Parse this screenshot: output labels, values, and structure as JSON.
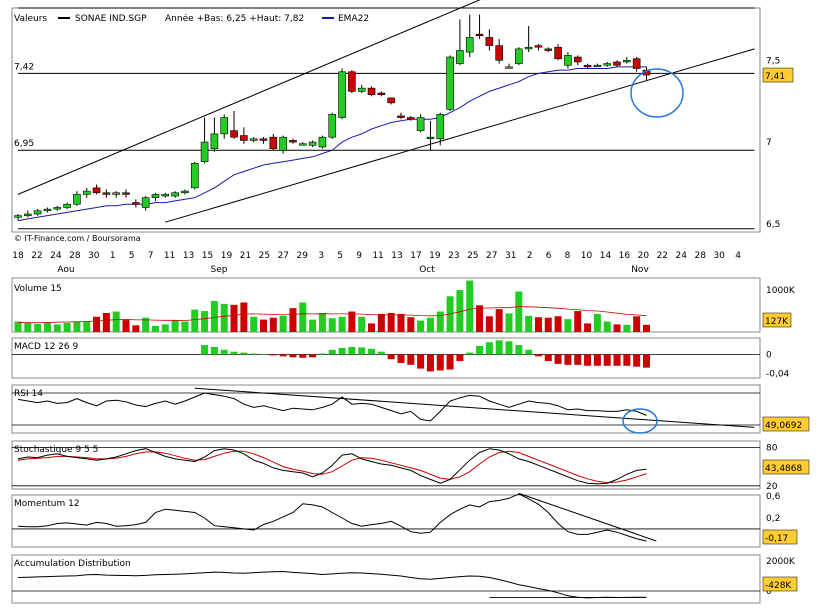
{
  "header": {
    "valeurs": "Valeurs",
    "symbol": "SONAE IND.SGP",
    "range": "Année +Bas: 6,25 +Haut: 7,82",
    "ema": "EMA22"
  },
  "colors": {
    "up": "#22cc22",
    "down": "#cc0000",
    "ema": "#1a1aaa",
    "badge": "#ffcc33",
    "highlight": "#2277dd",
    "grid_line": "#000000"
  },
  "chart_data": [
    {
      "type": "candlestick",
      "title": "SONAE IND.SGP",
      "legend": [
        "SONAE IND.SGP",
        "EMA22"
      ],
      "credit": "© IT-Finance.com / Boursorama",
      "ylim": [
        6.45,
        7.82
      ],
      "y_ticks_right": [
        7.5,
        7,
        6.5
      ],
      "y_tick_labels_right": [
        "7,5",
        "7",
        "6,5"
      ],
      "h_levels": [
        7.42,
        6.95
      ],
      "h_level_labels": [
        "7,42",
        "6,95"
      ],
      "current": "7,41",
      "x_tick_labels": [
        "18",
        "22",
        "24",
        "28",
        "30",
        "1",
        "5",
        "7",
        "11",
        "13",
        "15",
        "19",
        "21",
        "25",
        "27",
        "29",
        "3",
        "5",
        "9",
        "11",
        "13",
        "17",
        "19",
        "23",
        "25",
        "27",
        "31",
        "2",
        "6",
        "8",
        "10",
        "14",
        "16",
        "20",
        "22",
        "24",
        "28",
        "30",
        "4"
      ],
      "month_labels": [
        "Aou",
        "Sep",
        "Oct",
        "Nov"
      ],
      "candles": [
        [
          6.54,
          6.55,
          6.52,
          6.56
        ],
        [
          6.55,
          6.56,
          6.54,
          6.58
        ],
        [
          6.56,
          6.58,
          6.55,
          6.59
        ],
        [
          6.58,
          6.59,
          6.57,
          6.6
        ],
        [
          6.59,
          6.6,
          6.58,
          6.61
        ],
        [
          6.6,
          6.62,
          6.59,
          6.63
        ],
        [
          6.62,
          6.68,
          6.61,
          6.7
        ],
        [
          6.68,
          6.7,
          6.66,
          6.72
        ],
        [
          6.72,
          6.69,
          6.68,
          6.74
        ],
        [
          6.69,
          6.68,
          6.66,
          6.71
        ],
        [
          6.68,
          6.69,
          6.66,
          6.7
        ],
        [
          6.69,
          6.68,
          6.66,
          6.71
        ],
        [
          6.63,
          6.62,
          6.6,
          6.65
        ],
        [
          6.6,
          6.66,
          6.58,
          6.67
        ],
        [
          6.66,
          6.68,
          6.64,
          6.69
        ],
        [
          6.67,
          6.68,
          6.66,
          6.69
        ],
        [
          6.67,
          6.69,
          6.66,
          6.7
        ],
        [
          6.69,
          6.7,
          6.68,
          6.71
        ],
        [
          6.72,
          6.87,
          6.71,
          6.88
        ],
        [
          6.88,
          7.0,
          6.87,
          7.15
        ],
        [
          6.96,
          7.05,
          6.94,
          7.15
        ],
        [
          7.05,
          7.15,
          7.02,
          7.17
        ],
        [
          7.07,
          7.03,
          7.02,
          7.19
        ],
        [
          7.04,
          7.01,
          6.99,
          7.09
        ],
        [
          7.01,
          7.02,
          7.0,
          7.03
        ],
        [
          7.02,
          7.01,
          6.99,
          7.03
        ],
        [
          7.03,
          6.96,
          6.95,
          7.05
        ],
        [
          6.95,
          7.03,
          6.93,
          7.04
        ],
        [
          7.01,
          7.0,
          6.99,
          7.02
        ],
        [
          6.99,
          6.99,
          6.98,
          7.0
        ],
        [
          6.98,
          7.0,
          6.97,
          7.01
        ],
        [
          6.97,
          7.03,
          6.96,
          7.04
        ],
        [
          7.03,
          7.17,
          7.02,
          7.18
        ],
        [
          7.15,
          7.43,
          7.14,
          7.45
        ],
        [
          7.43,
          7.31,
          7.3,
          7.44
        ],
        [
          7.31,
          7.33,
          7.3,
          7.35
        ],
        [
          7.33,
          7.29,
          7.28,
          7.34
        ],
        [
          7.3,
          7.29,
          7.28,
          7.31
        ],
        [
          7.27,
          7.24,
          7.23,
          7.27
        ],
        [
          7.16,
          7.15,
          7.14,
          7.18
        ],
        [
          7.15,
          7.14,
          7.13,
          7.16
        ],
        [
          7.07,
          7.15,
          7.06,
          7.17
        ],
        [
          7.03,
          7.03,
          6.95,
          7.13
        ],
        [
          7.02,
          7.17,
          6.98,
          7.18
        ],
        [
          7.2,
          7.52,
          7.19,
          7.53
        ],
        [
          7.48,
          7.56,
          7.47,
          7.75
        ],
        [
          7.55,
          7.64,
          7.52,
          7.78
        ],
        [
          7.66,
          7.65,
          7.63,
          7.78
        ],
        [
          7.64,
          7.59,
          7.56,
          7.69
        ],
        [
          7.59,
          7.5,
          7.48,
          7.63
        ],
        [
          7.46,
          7.46,
          7.45,
          7.48
        ],
        [
          7.48,
          7.57,
          7.47,
          7.58
        ],
        [
          7.57,
          7.58,
          7.55,
          7.71
        ],
        [
          7.59,
          7.58,
          7.56,
          7.6
        ],
        [
          7.57,
          7.56,
          7.55,
          7.58
        ],
        [
          7.58,
          7.51,
          7.5,
          7.6
        ],
        [
          7.47,
          7.53,
          7.45,
          7.55
        ],
        [
          7.52,
          7.49,
          7.47,
          7.53
        ],
        [
          7.47,
          7.46,
          7.45,
          7.48
        ],
        [
          7.47,
          7.47,
          7.46,
          7.48
        ],
        [
          7.47,
          7.48,
          7.46,
          7.49
        ],
        [
          7.49,
          7.47,
          7.46,
          7.5
        ],
        [
          7.49,
          7.5,
          7.48,
          7.52
        ],
        [
          7.51,
          7.45,
          7.43,
          7.52
        ],
        [
          7.44,
          7.41,
          7.38,
          7.46
        ]
      ],
      "ema22": [
        6.52,
        6.53,
        6.54,
        6.55,
        6.56,
        6.57,
        6.58,
        6.59,
        6.6,
        6.61,
        6.61,
        6.62,
        6.62,
        6.62,
        6.63,
        6.63,
        6.64,
        6.65,
        6.66,
        6.69,
        6.72,
        6.76,
        6.8,
        6.82,
        6.84,
        6.86,
        6.87,
        6.88,
        6.89,
        6.9,
        6.91,
        6.93,
        6.95,
        7.0,
        7.03,
        7.05,
        7.08,
        7.1,
        7.12,
        7.13,
        7.14,
        7.14,
        7.14,
        7.15,
        7.18,
        7.21,
        7.25,
        7.28,
        7.31,
        7.33,
        7.35,
        7.37,
        7.4,
        7.42,
        7.43,
        7.44,
        7.44,
        7.45,
        7.45,
        7.45,
        7.45,
        7.46,
        7.46,
        7.46,
        7.46
      ],
      "trendlines": [
        {
          "x1": 0,
          "y1": 6.68,
          "x2": 49,
          "y2": 7.92
        },
        {
          "x1": 15,
          "y1": 6.51,
          "x2": 75,
          "y2": 7.57
        },
        {
          "x1": 0,
          "y1": 7.42,
          "x2": 75,
          "y2": 7.42
        },
        {
          "x1": 0,
          "y1": 6.95,
          "x2": 75,
          "y2": 6.95
        },
        {
          "x1": 0,
          "y1": 6.47,
          "x2": 75,
          "y2": 6.47
        },
        {
          "x1": 0,
          "y1": 7.82,
          "x2": 75,
          "y2": 7.82
        }
      ]
    },
    {
      "type": "bar",
      "title": "Volume 15",
      "ylim": [
        0,
        1050
      ],
      "y_ticks": [
        1000
      ],
      "y_tick_labels": [
        "1000K"
      ],
      "current": "127K",
      "values": [
        220,
        190,
        170,
        200,
        160,
        190,
        210,
        220,
        320,
        400,
        430,
        250,
        140,
        300,
        130,
        160,
        250,
        220,
        470,
        440,
        650,
        590,
        570,
        620,
        320,
        260,
        300,
        340,
        500,
        620,
        260,
        400,
        290,
        320,
        430,
        320,
        180,
        380,
        400,
        380,
        310,
        240,
        300,
        430,
        750,
        880,
        1080,
        560,
        330,
        480,
        390,
        850,
        340,
        310,
        300,
        330,
        270,
        440,
        180,
        380,
        220,
        160,
        150,
        330,
        150
      ],
      "colors_by_candle": true,
      "ma": [
        200,
        195,
        195,
        200,
        205,
        210,
        215,
        220,
        230,
        245,
        260,
        265,
        255,
        255,
        250,
        245,
        245,
        240,
        260,
        280,
        305,
        330,
        350,
        375,
        380,
        375,
        370,
        360,
        370,
        385,
        380,
        385,
        380,
        380,
        380,
        375,
        365,
        360,
        360,
        360,
        355,
        345,
        340,
        345,
        380,
        425,
        480,
        500,
        505,
        510,
        510,
        535,
        530,
        520,
        510,
        500,
        480,
        470,
        450,
        440,
        420,
        395,
        370,
        360,
        340
      ]
    },
    {
      "type": "bar",
      "title": "MACD 12 26 9",
      "ylim": [
        -0.05,
        0.035
      ],
      "y_ticks": [
        0,
        -0.04
      ],
      "y_tick_labels": [
        "0",
        "-0,04"
      ],
      "values_start": 19,
      "values": [
        0.02,
        0.016,
        0.01,
        0.006,
        0.004,
        0.002,
        0.001,
        -0.002,
        -0.004,
        -0.006,
        -0.007,
        -0.006,
        0.002,
        0.01,
        0.014,
        0.016,
        0.015,
        0.012,
        0.006,
        -0.01,
        -0.018,
        -0.022,
        -0.03,
        -0.036,
        -0.034,
        -0.032,
        -0.014,
        0.004,
        0.018,
        0.026,
        0.03,
        0.028,
        0.02,
        0.01,
        -0.004,
        -0.014,
        -0.02,
        -0.022,
        -0.022,
        -0.024,
        -0.024,
        -0.024,
        -0.024,
        -0.024,
        -0.026,
        -0.028
      ]
    },
    {
      "type": "line",
      "title": "RSI 14",
      "current": "49,0692",
      "ylim": [
        20,
        80
      ],
      "levels": [
        70,
        30
      ],
      "values": [
        62,
        60,
        58,
        60,
        57,
        58,
        63,
        58,
        54,
        60,
        61,
        59,
        55,
        53,
        57,
        60,
        56,
        60,
        65,
        70,
        68,
        66,
        63,
        56,
        52,
        54,
        51,
        48,
        51,
        50,
        49,
        52,
        56,
        65,
        56,
        57,
        56,
        52,
        48,
        44,
        47,
        37,
        35,
        47,
        60,
        64,
        67,
        66,
        60,
        56,
        52,
        56,
        60,
        58,
        57,
        54,
        49,
        50,
        48,
        48,
        47,
        47,
        49,
        47,
        42
      ],
      "trendline": {
        "x1": 18,
        "y1": 76,
        "x2": 75,
        "y2": 27
      }
    },
    {
      "type": "line",
      "title": "Stochastique 9 5 5",
      "current": "43,4868",
      "ylim": [
        15,
        90
      ],
      "levels": [
        80,
        20
      ],
      "k_line": [
        62,
        65,
        64,
        68,
        70,
        66,
        64,
        62,
        60,
        62,
        65,
        70,
        75,
        78,
        72,
        66,
        62,
        60,
        58,
        65,
        75,
        78,
        76,
        70,
        60,
        55,
        48,
        44,
        42,
        40,
        34,
        40,
        52,
        68,
        70,
        62,
        58,
        54,
        52,
        48,
        44,
        36,
        30,
        24,
        30,
        45,
        60,
        72,
        78,
        76,
        70,
        62,
        58,
        52,
        46,
        40,
        34,
        28,
        24,
        23,
        24,
        30,
        38,
        44,
        46
      ],
      "d_line": [
        60,
        62,
        63,
        64,
        66,
        66,
        65,
        64,
        62,
        62,
        63,
        66,
        70,
        73,
        73,
        71,
        67,
        63,
        60,
        61,
        66,
        71,
        74,
        74,
        70,
        64,
        57,
        50,
        46,
        43,
        39,
        38,
        42,
        51,
        60,
        64,
        63,
        60,
        56,
        52,
        48,
        44,
        38,
        32,
        30,
        34,
        42,
        54,
        65,
        72,
        74,
        72,
        66,
        60,
        54,
        48,
        42,
        36,
        31,
        27,
        25,
        26,
        29,
        34,
        39
      ]
    },
    {
      "type": "line",
      "title": "Momentum 12",
      "current": "-0,17",
      "ylim": [
        -0.33,
        0.62
      ],
      "y_ticks": [
        0.6,
        0.2,
        -0.2
      ],
      "y_tick_labels": [
        "0,6",
        "0,2",
        "-0,2"
      ],
      "levels": [
        0
      ],
      "values": [
        0.05,
        0.04,
        0.04,
        0.06,
        0.1,
        0.11,
        0.09,
        0.07,
        0.12,
        0.1,
        0.05,
        0.06,
        0.08,
        0.12,
        0.3,
        0.36,
        0.34,
        0.32,
        0.3,
        0.2,
        0.06,
        0.04,
        0.02,
        0.0,
        -0.02,
        0.08,
        0.14,
        0.22,
        0.3,
        0.46,
        0.44,
        0.4,
        0.3,
        0.2,
        0.1,
        0.05,
        0.08,
        0.1,
        0.14,
        0.05,
        -0.05,
        -0.08,
        -0.06,
        0.12,
        0.26,
        0.36,
        0.44,
        0.4,
        0.5,
        0.52,
        0.56,
        0.64,
        0.55,
        0.45,
        0.3,
        0.1,
        -0.05,
        -0.1,
        -0.1,
        -0.06,
        -0.02,
        -0.06,
        -0.12,
        -0.18,
        -0.22
      ],
      "trendline": {
        "x1": 51,
        "y1": 0.65,
        "x2": 65,
        "y2": -0.22
      }
    },
    {
      "type": "line",
      "title": "Accumulation Distribution",
      "current": "-428K",
      "ylim": [
        -800,
        2400
      ],
      "y_ticks": [
        2000,
        0
      ],
      "y_tick_labels": [
        "2000K",
        "0"
      ],
      "levels": [
        0
      ],
      "values": [
        900,
        920,
        940,
        960,
        980,
        1000,
        1020,
        1080,
        1100,
        1060,
        1040,
        1030,
        1020,
        1040,
        1080,
        1100,
        1120,
        1140,
        1180,
        1220,
        1260,
        1240,
        1200,
        1180,
        1220,
        1260,
        1280,
        1300,
        1240,
        1200,
        1160,
        1100,
        1140,
        1180,
        1220,
        1200,
        1160,
        1120,
        1060,
        1000,
        900,
        820,
        780,
        840,
        900,
        960,
        1000,
        980,
        900,
        760,
        600,
        420,
        300,
        160,
        40,
        -120,
        -320,
        -420,
        -460,
        -430,
        -420,
        -430,
        -428,
        -420,
        -428
      ],
      "ref_level": -428
    }
  ]
}
